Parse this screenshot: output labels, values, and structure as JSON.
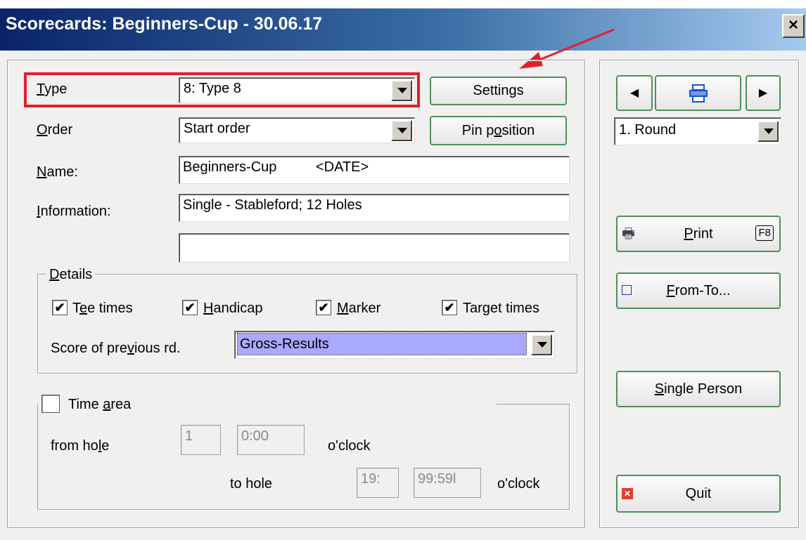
{
  "window": {
    "title": "Scorecards: Beginners-Cup - 30.06.17",
    "close_glyph": "×"
  },
  "form": {
    "type_label_first": "T",
    "type_label_rest": "ype",
    "type_value": "8: Type 8",
    "settings_button": "Settings",
    "order_label_first": "O",
    "order_label_rest": "rder",
    "order_value": "Start order",
    "pin_button_pre": "Pin p",
    "pin_button_u": "o",
    "pin_button_post": "sition",
    "name_label_first": "N",
    "name_label_rest": "ame:",
    "name_value": "Beginners-Cup          <DATE>",
    "info_label_first": "I",
    "info_label_rest": "nformation:",
    "info_value": "Single - Stableford; 12 Holes",
    "info_value2": ""
  },
  "details": {
    "legend_first": "D",
    "legend_rest": "etails",
    "tee_pre": "T",
    "tee_u": "e",
    "tee_post": "e times",
    "tee_checked": true,
    "hcp_first": "H",
    "hcp_rest": "andicap",
    "hcp_checked": true,
    "marker_first": "M",
    "marker_rest": "arker",
    "marker_checked": true,
    "target_pre": "Tar",
    "target_u": "g",
    "target_post": "et times",
    "target_checked": true,
    "score_label_pre": "Score of pre",
    "score_label_u": "v",
    "score_label_post": "ious rd.",
    "score_value": "Gross-Results",
    "check_glyph": "✔"
  },
  "time_area": {
    "label_pre": "Time ",
    "label_u": "a",
    "label_post": "rea",
    "checked": false,
    "from_hole_pre": "from ho",
    "from_hole_u": "l",
    "from_hole_post": "e",
    "from_hole_value": "1",
    "from_time_value": "0:00",
    "oclock1": "o'clock",
    "to_hole_label": "to hole",
    "to_hole_value": "19:",
    "to_time_value": "99:59l",
    "oclock2": "o'clock"
  },
  "side": {
    "prev_icon": "◀",
    "next_icon": "▶",
    "round_value": "1. Round",
    "print_u": "P",
    "print_rest": "rint",
    "print_key": "F8",
    "fromto_u": "F",
    "fromto_rest": "rom-To...",
    "single_u": "S",
    "single_rest": "ingle Person",
    "quit_label": "Quit",
    "quit_icon": "✕"
  },
  "colors": {
    "accent_red": "#e0202a",
    "score_select_bg": "#a9a9ff",
    "button_border": "#4f8f5a"
  }
}
